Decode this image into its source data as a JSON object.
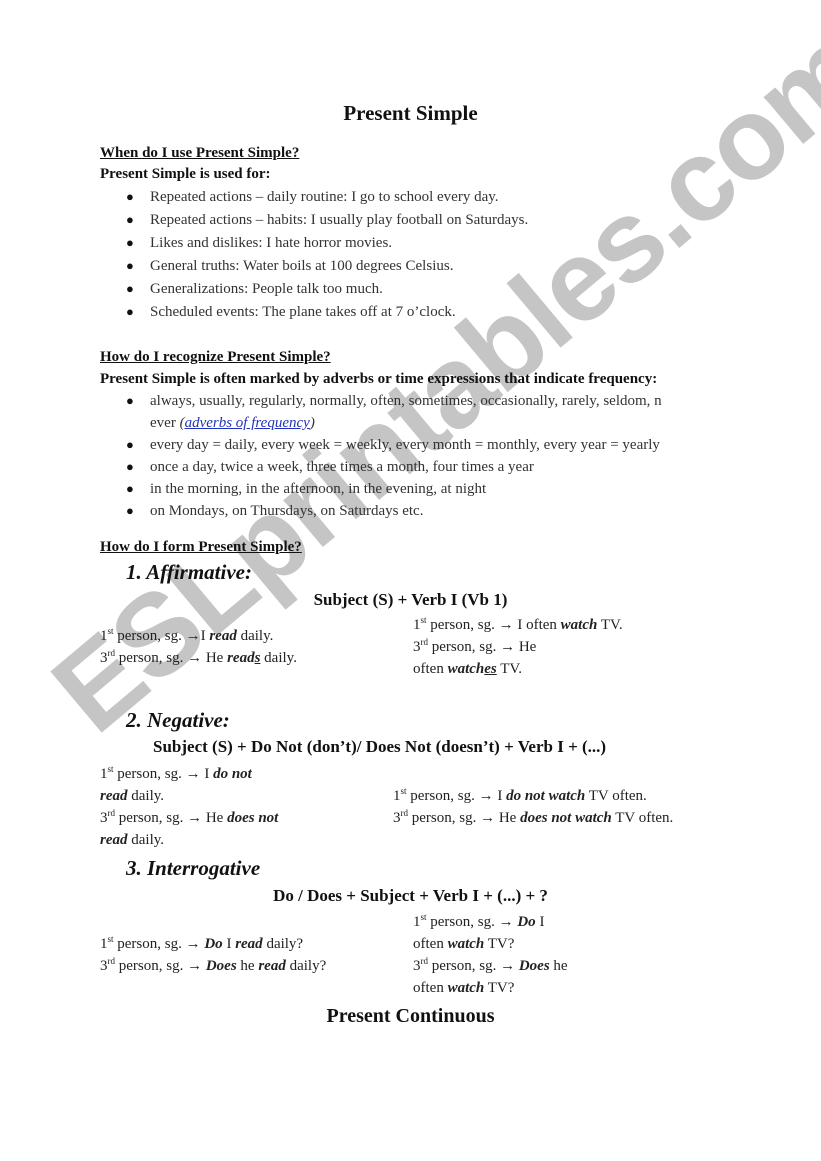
{
  "document": {
    "title": "Present Simple",
    "watermark": "ESLprintables.com",
    "section_use": {
      "heading": "When do I use Present Simple?",
      "lead": "Present Simple is used for:",
      "items": [
        "Repeated actions – daily routine: I go to school every day.",
        "Repeated actions – habits: I usually play football on Saturdays.",
        "Likes and dislikes: I hate horror movies.",
        "General truths: Water boils at 100 degrees Celsius.",
        "Generalizations: People talk too much.",
        "Scheduled events: The plane takes off at 7 o’clock."
      ]
    },
    "section_recognize": {
      "heading": "How do I recognize Present Simple?",
      "lead": "Present Simple is often marked by adverbs or time expressions that indicate frequency:",
      "item1_line1": "always, usually, regularly, normally, often, sometimes, occasionally, rarely, seldom, n",
      "item1_line2_prefix": "ever ",
      "item1_paren_open": "(",
      "item1_link": "adverbs of frequency",
      "item1_paren_close": ")",
      "items": [
        "every day = daily, every week = weekly, every month = monthly, every year = yearly",
        "once a day, twice a week, three times a month, four times a year",
        "in the morning, in the afternoon, in the evening, at night",
        "on Mondays, on Thursdays, on Saturdays etc."
      ]
    },
    "section_form": {
      "heading": "How do I form Present Simple?",
      "affirmative": {
        "label": "1.  Affirmative:",
        "formula": "Subject (S) + Verb I (Vb 1)",
        "left": {
          "l1_num": "1",
          "l1_sup": "st",
          "l1_a": " person, sg. →I ",
          "l1_b": "read",
          "l1_c": " daily.",
          "l2_num": "3",
          "l2_sup": "rd",
          "l2_a": " person, sg. → He ",
          "l2_b1": "read",
          "l2_b2": "s",
          "l2_c": " daily."
        },
        "right": {
          "l1_num": "1",
          "l1_sup": "st",
          "l1_a": " person, sg. → I often ",
          "l1_b": "watch",
          "l1_c": " TV.",
          "l2_num": "3",
          "l2_sup": "rd",
          "l2_a": " person, sg. → He",
          "l3_a": "often ",
          "l3_b1": "watch",
          "l3_b2": "es",
          "l3_c": " TV."
        }
      },
      "negative": {
        "label": "2.  Negative:",
        "formula": "Subject (S) + Do Not (don’t)/ Does Not (doesn’t) + Verb I + (...)",
        "left": {
          "l1_num": "1",
          "l1_sup": "st",
          "l1_a": " person, sg. → I ",
          "l1_b": "do not",
          "l2_b": "read",
          "l2_c": " daily.",
          "l3_num": "3",
          "l3_sup": "rd",
          "l3_a": " person, sg. → He ",
          "l3_b": "does not",
          "l4_b": "read",
          "l4_c": " daily."
        },
        "right": {
          "l1_num": "1",
          "l1_sup": "st",
          "l1_a": " person, sg. → I ",
          "l1_b": "do not watch",
          "l1_c": " TV often.",
          "l2_num": "3",
          "l2_sup": "rd",
          "l2_a": " person, sg. → He ",
          "l2_b": "does not watch",
          "l2_c": " TV often."
        }
      },
      "interrogative": {
        "label": "3.  Interrogative",
        "formula": "Do / Does + Subject + Verb I + (...) + ?",
        "left": {
          "l1_num": "1",
          "l1_sup": "st",
          "l1_a": " person, sg. → ",
          "l1_b": "Do",
          "l1_c": " I ",
          "l1_d": "read",
          "l1_e": " daily?",
          "l2_num": "3",
          "l2_sup": "rd",
          "l2_a": " person, sg. → ",
          "l2_b": "Does",
          "l2_c": " he ",
          "l2_d": "read",
          "l2_e": " daily?"
        },
        "right": {
          "l1_num": "1",
          "l1_sup": "st",
          "l1_a": " person, sg. → ",
          "l1_b": "Do",
          "l1_c": " I",
          "l2_a": "often ",
          "l2_b": "watch",
          "l2_c": " TV?",
          "l3_num": "3",
          "l3_sup": "rd",
          "l3_a": " person, sg. → ",
          "l3_b": "Does",
          "l3_c": " he",
          "l4_a": "often ",
          "l4_b": "watch",
          "l4_c": " TV?"
        }
      }
    },
    "next_title": "Present Continuous"
  },
  "colors": {
    "link": "#2233bb",
    "watermark": "#969696"
  }
}
